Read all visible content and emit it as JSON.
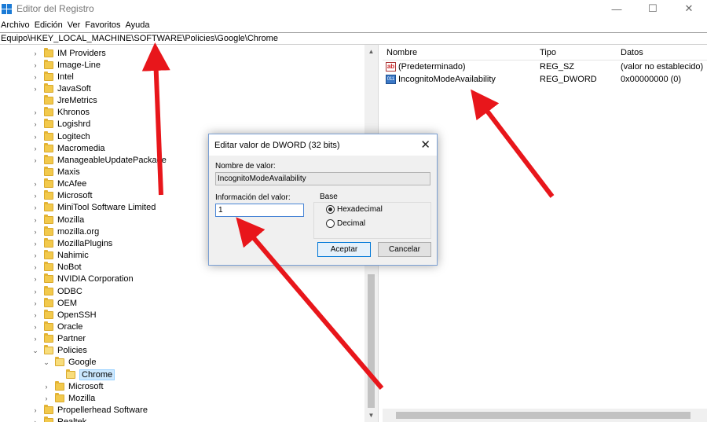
{
  "window": {
    "title": "Editor del Registro",
    "minimize": "—",
    "maximize": "☐",
    "close": "✕"
  },
  "menu": [
    "Archivo",
    "Edición",
    "Ver",
    "Favoritos",
    "Ayuda"
  ],
  "address": "Equipo\\HKEY_LOCAL_MACHINE\\SOFTWARE\\Policies\\Google\\Chrome",
  "tree": [
    {
      "label": "IM Providers",
      "expander": "›"
    },
    {
      "label": "Image-Line",
      "expander": "›"
    },
    {
      "label": "Intel",
      "expander": "›"
    },
    {
      "label": "JavaSoft",
      "expander": "›"
    },
    {
      "label": "JreMetrics",
      "expander": ""
    },
    {
      "label": "Khronos",
      "expander": "›"
    },
    {
      "label": "Logishrd",
      "expander": "›"
    },
    {
      "label": "Logitech",
      "expander": "›"
    },
    {
      "label": "Macromedia",
      "expander": "›"
    },
    {
      "label": "ManageableUpdatePackage",
      "expander": "›"
    },
    {
      "label": "Maxis",
      "expander": ""
    },
    {
      "label": "McAfee",
      "expander": "›"
    },
    {
      "label": "Microsoft",
      "expander": "›"
    },
    {
      "label": "MiniTool Software Limited",
      "expander": "›"
    },
    {
      "label": "Mozilla",
      "expander": "›"
    },
    {
      "label": "mozilla.org",
      "expander": "›"
    },
    {
      "label": "MozillaPlugins",
      "expander": "›"
    },
    {
      "label": "Nahimic",
      "expander": "›"
    },
    {
      "label": "NoBot",
      "expander": "›"
    },
    {
      "label": "NVIDIA Corporation",
      "expander": "›"
    },
    {
      "label": "ODBC",
      "expander": "›"
    },
    {
      "label": "OEM",
      "expander": "›"
    },
    {
      "label": "OpenSSH",
      "expander": "›"
    },
    {
      "label": "Oracle",
      "expander": "›"
    },
    {
      "label": "Partner",
      "expander": "›"
    },
    {
      "label": "Policies",
      "expander": "⌄"
    },
    {
      "label": "Google",
      "expander": "⌄"
    },
    {
      "label": "Chrome",
      "expander": ""
    },
    {
      "label": "Microsoft",
      "expander": "›"
    },
    {
      "label": "Mozilla",
      "expander": "›"
    },
    {
      "label": "Propellerhead Software",
      "expander": "›"
    },
    {
      "label": "Realtek",
      "expander": "›"
    }
  ],
  "list": {
    "columns": [
      "Nombre",
      "Tipo",
      "Datos"
    ],
    "rows": [
      {
        "icon": "ab",
        "name": "(Predeterminado)",
        "type": "REG_SZ",
        "data": "(valor no establecido)"
      },
      {
        "icon": "011",
        "name": "IncognitoModeAvailability",
        "type": "REG_DWORD",
        "data": "0x00000000 (0)"
      }
    ]
  },
  "dialog": {
    "title": "Editar valor de DWORD (32 bits)",
    "close": "✕",
    "name_label": "Nombre de valor:",
    "name_value": "IncognitoModeAvailability",
    "data_label": "Información del valor:",
    "data_value": "1",
    "base_label": "Base",
    "radio_hex": "Hexadecimal",
    "radio_dec": "Decimal",
    "ok": "Aceptar",
    "cancel": "Cancelar"
  },
  "colors": {
    "arrow": "#e8161b",
    "selection": "#cce8ff",
    "accent": "#0078d7"
  }
}
